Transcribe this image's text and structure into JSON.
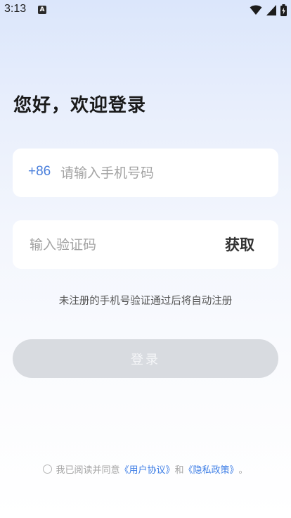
{
  "status_bar": {
    "time": "3:13",
    "notification_badge": "A"
  },
  "greeting": "您好，欢迎登录",
  "phone_field": {
    "country_code": "+86",
    "value": "",
    "placeholder": "请输入手机号码"
  },
  "code_field": {
    "value": "",
    "placeholder": "输入验证码",
    "get_code_label": "获取"
  },
  "notice": "未注册的手机号验证通过后将自动注册",
  "login_button_label": "登录",
  "agreement": {
    "checked": false,
    "prefix": "我已阅读并同意",
    "user_agreement_link": "《用户协议》",
    "conjunction": "和",
    "privacy_policy_link": "《隐私政策》",
    "suffix": "。"
  },
  "colors": {
    "accent": "#4a7fdc",
    "link": "#3d7ee6",
    "button_disabled": "#d8dbe0",
    "background_top": "#dbe6fb"
  },
  "icons": [
    "wifi-icon",
    "cell-signal-icon",
    "battery-icon"
  ]
}
